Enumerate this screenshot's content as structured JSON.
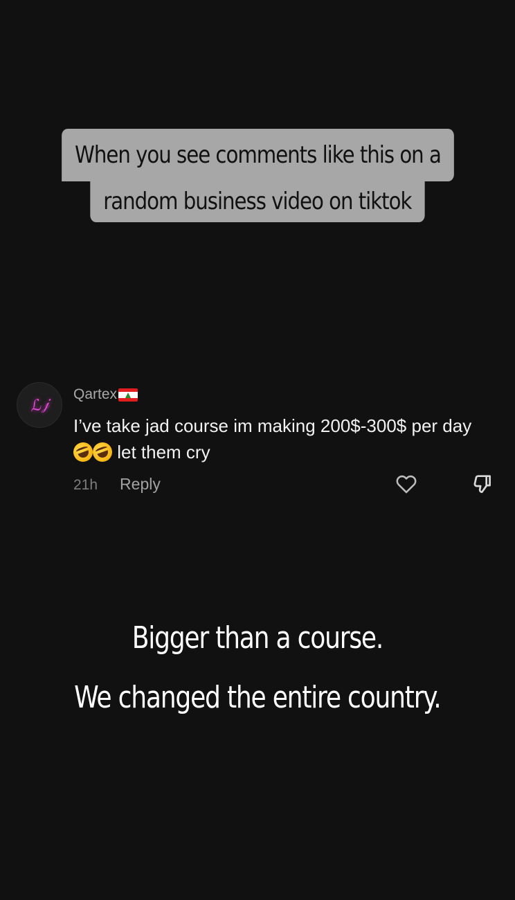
{
  "caption": {
    "line1": "When you see comments like this on a",
    "line2": "random business video on tiktok"
  },
  "comment": {
    "avatar_icon": "neon-signature-avatar",
    "username": "Qartex",
    "flag_icon": "lebanon-flag-icon",
    "text_part1": "I’ve take jad course im making 200$-300$ per day",
    "emoji_icon": "rolling-on-floor-laughing-emoji",
    "text_part2": " let them cry",
    "time": "21h",
    "reply_label": "Reply",
    "like_icon": "heart-icon",
    "dislike_icon": "thumbs-down-icon"
  },
  "tagline": {
    "line1": "Bigger than a course.",
    "line2": "We changed the entire country."
  },
  "colors": {
    "background": "#111111",
    "caption_bg": "#a7a7a7",
    "caption_text": "#111111",
    "username": "#a9a9a9",
    "meta": "#7e7e7e",
    "avatar_neon": "#e24bd3"
  }
}
